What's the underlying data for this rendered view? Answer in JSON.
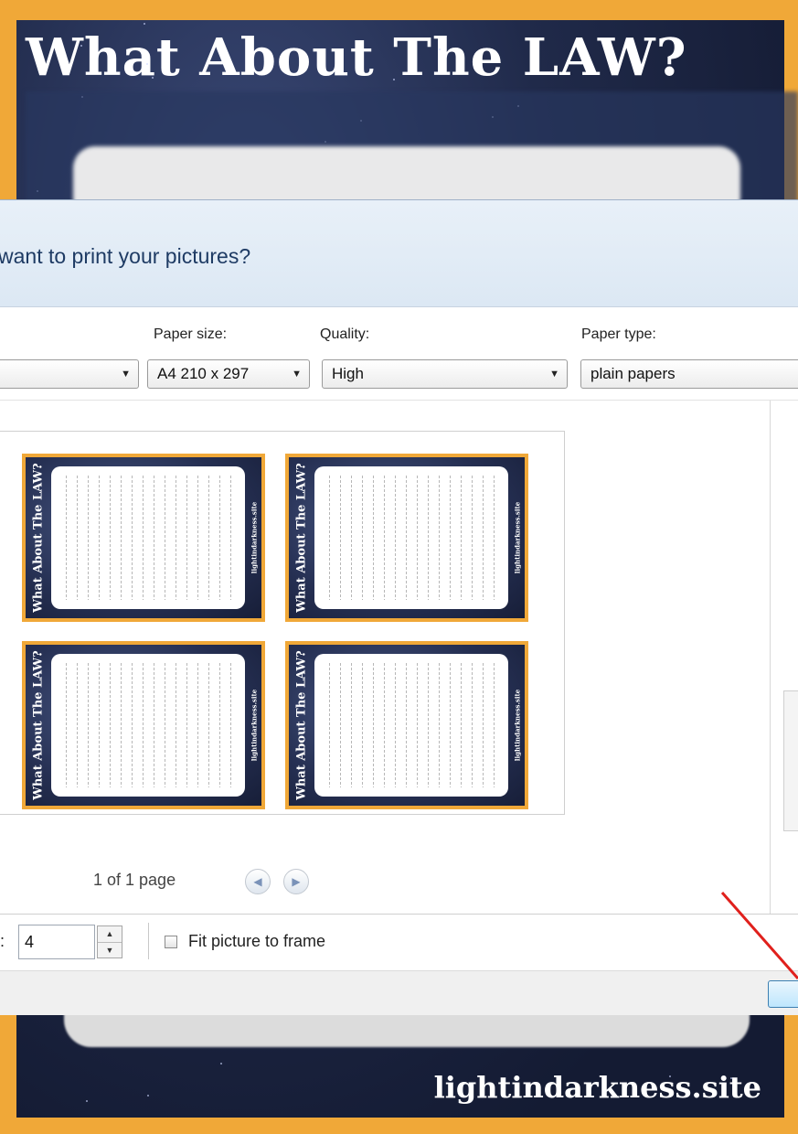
{
  "poster": {
    "title": "What About The LAW?",
    "footer": "lightindarkness.site"
  },
  "dialog": {
    "question": "want to print your pictures?",
    "paper_size": {
      "label": "Paper size:",
      "value": "A4 210 x 297"
    },
    "quality": {
      "label": "Quality:",
      "value": "High"
    },
    "paper_type": {
      "label": "Paper type:",
      "value": "plain papers"
    },
    "preview": {
      "cards": [
        {
          "title": "What About The LAW?",
          "footer": "lightindarkness.site"
        },
        {
          "title": "What About The LAW?",
          "footer": "lightindarkness.site"
        },
        {
          "title": "What About The LAW?",
          "footer": "lightindarkness.site"
        },
        {
          "title": "What About The LAW?",
          "footer": "lightindarkness.site"
        }
      ]
    },
    "pager": {
      "text": "1 of 1 page"
    },
    "copies": {
      "colon": ":",
      "value": "4"
    },
    "fit_picture": {
      "label": "Fit picture to frame",
      "checked": false
    }
  },
  "colors": {
    "accent_border": "#f0a838",
    "header_text": "#1e3b64",
    "annotation_arrow": "#e0201c"
  }
}
